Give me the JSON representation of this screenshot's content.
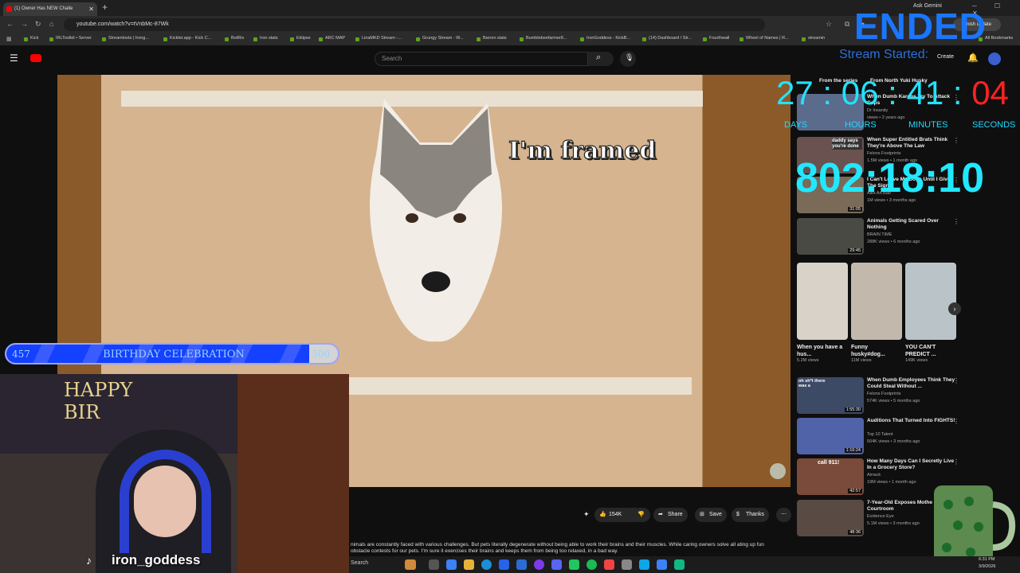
{
  "browser": {
    "tab_title": "(1) Owner Has NEW Challe",
    "new_tab": "+",
    "ask_gemini": "Ask Gemini",
    "url": "youtube.com/watch?v=tVnbMc-87Wk",
    "finish_update": "Finish update",
    "all_bookmarks": "All Bookmarks",
    "bookmarks": [
      "Kick",
      "IRLToolkit • Server",
      "Streamloots | Irong...",
      "Kicklet.app - Kick C...",
      "BotRix",
      "Iron stats",
      "Eklipse",
      "ARC MAP",
      "LinaMKD Stream -...",
      "Grungy Stream - W...",
      "Barren stats",
      "Bumblebeefarmer8...",
      "IronGoddess - KickB...",
      "(14) Dashboard / Str...",
      "Fourthwall",
      "Wheel of Names | R...",
      "streamin"
    ]
  },
  "youtube": {
    "search_placeholder": "Search",
    "create_label": "Create"
  },
  "video": {
    "caption": "I'm framed"
  },
  "actions": {
    "likes": "154K",
    "share": "Share",
    "save": "Save",
    "thanks": "Thanks",
    "more": "⋯"
  },
  "description": "nimals are constantly faced with various challenges. But pets literally degenerate without being able to work their brains and their muscles. While caring owners solve all ating up fun obstacle contests for our pets. I'm sure it exercises their brains and keeps them from being too relaxed, in a bad way.",
  "sidebar": {
    "chips": [
      "From the series",
      "From North Yuki Husky"
    ],
    "recs": [
      {
        "title": "When Dumb Karens Try To Attack Cops",
        "channel": "Dr Insanity",
        "views": "views • 2 years ago",
        "duration": ""
      },
      {
        "title": "When Super Entitled Brats Think They're Above The Law",
        "channel": "Felons Footprints",
        "views": "1.5M views • 1 month ago",
        "duration": ""
      },
      {
        "title": "I Can't Leave My Dogs Until I Give The Signal",
        "channel": "Alex An Bao",
        "views": "1M views • 3 months ago",
        "duration": "31:05"
      },
      {
        "title": "Animals Getting Scared Over Nothing",
        "channel": "BRAIN TIME",
        "views": "288K views • 6 months ago",
        "duration": "29:45"
      },
      {
        "title": "When Dumb Employees Think They Could Steal Without ...",
        "channel": "Felons Footprints",
        "views": "574K views • 5 months ago",
        "duration": "1:55:30"
      },
      {
        "title": "Auditions That Turned Into FIGHTS!",
        "channel": "Top 10 Talent",
        "views": "504K views • 3 months ago",
        "duration": "1:16:24"
      },
      {
        "title": "How Many Days Can I Secretly Live In a Grocery Store?",
        "channel": "Airrack",
        "views": "19M views • 1 month ago",
        "duration": "42:57"
      },
      {
        "title": "7-Year-Old Exposes Mothe Courtroom",
        "channel": "Evidence Eye",
        "views": "5.1M views • 3 months ago",
        "duration": "48:36"
      }
    ],
    "shorts": [
      {
        "title": "When you have a hus...",
        "views": "5.2M views"
      },
      {
        "title": "Funny husky#dog...",
        "views": "11M views"
      },
      {
        "title": "YOU CAN'T PREDICT ...",
        "views": "149K views"
      }
    ],
    "thumb_texts": [
      "daddy says you're done",
      "oh sh*t there was a",
      "call 911!"
    ]
  },
  "overlay": {
    "ended": "ENDED",
    "stream_started": "Stream Started:",
    "countdown": {
      "days": "27",
      "hours": "06",
      "minutes": "41",
      "seconds": "04"
    },
    "countdown_labels": [
      "DAYS",
      "HOURS",
      "MINUTES",
      "SECONDS"
    ],
    "elapsed": "802:18:10",
    "goal": {
      "start": "457",
      "label": "BIRTHDAY CELEBRATION",
      "end": "500",
      "progress": 0.914
    },
    "webcam_banner": "HAPPY BIR",
    "tiktok_handle": "iron_goddess"
  },
  "taskbar": {
    "search": "Search",
    "clock_time": "6:31 PM",
    "clock_date": "3/9/2026"
  },
  "colors": {
    "accent_blue": "#1a76ff",
    "cyan": "#22e2ff",
    "red": "#ff2222",
    "youtube_red": "#ff0000"
  }
}
